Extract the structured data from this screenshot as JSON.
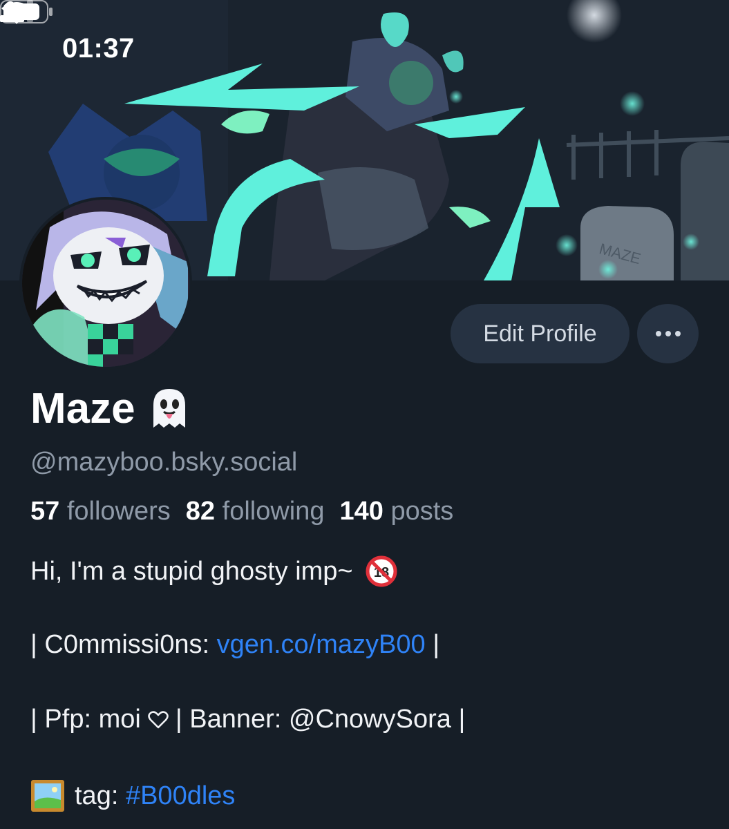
{
  "status_bar": {
    "time": "01:37",
    "icons": [
      "person-icon",
      "signal-icon",
      "wifi-icon",
      "battery-icon"
    ]
  },
  "banner": {
    "description_icon": "banner-artwork",
    "tombstone_text": "MAZE"
  },
  "profile": {
    "display_name": "Maze",
    "name_emoji": "ghost-emoji",
    "handle": "@mazyboo.bsky.social",
    "followers_count": "57",
    "followers_label": "followers",
    "following_count": "82",
    "following_label": "following",
    "posts_count": "140",
    "posts_label": "posts"
  },
  "actions": {
    "edit_profile_label": "Edit Profile",
    "more_icon": "ellipsis-icon"
  },
  "bio": {
    "line1_text": "Hi, I'm a stupid ghosty imp~",
    "line1_emoji": "no-under-18-emoji",
    "line2_pipe_left": "|",
    "line2_prefix": " C0mmissi0ns: ",
    "line2_link": "vgen.co/mazyB00",
    "line2_pipe_right": " |",
    "line3_pipe_left": "|",
    "line3_pfp": " Pfp: moi",
    "line3_heart": "heart-icon",
    "line3_mid": "| Banner: @CnowySora |",
    "line4_emoji": "framed-picture-emoji",
    "line4_prefix": "tag: ",
    "line4_tag": "#B00dles"
  },
  "colors": {
    "background": "#161e27",
    "button_bg": "#263242",
    "link": "#2f83f7",
    "muted_text": "#8f9aa8",
    "glow_cyan": "#5ff0dc"
  }
}
